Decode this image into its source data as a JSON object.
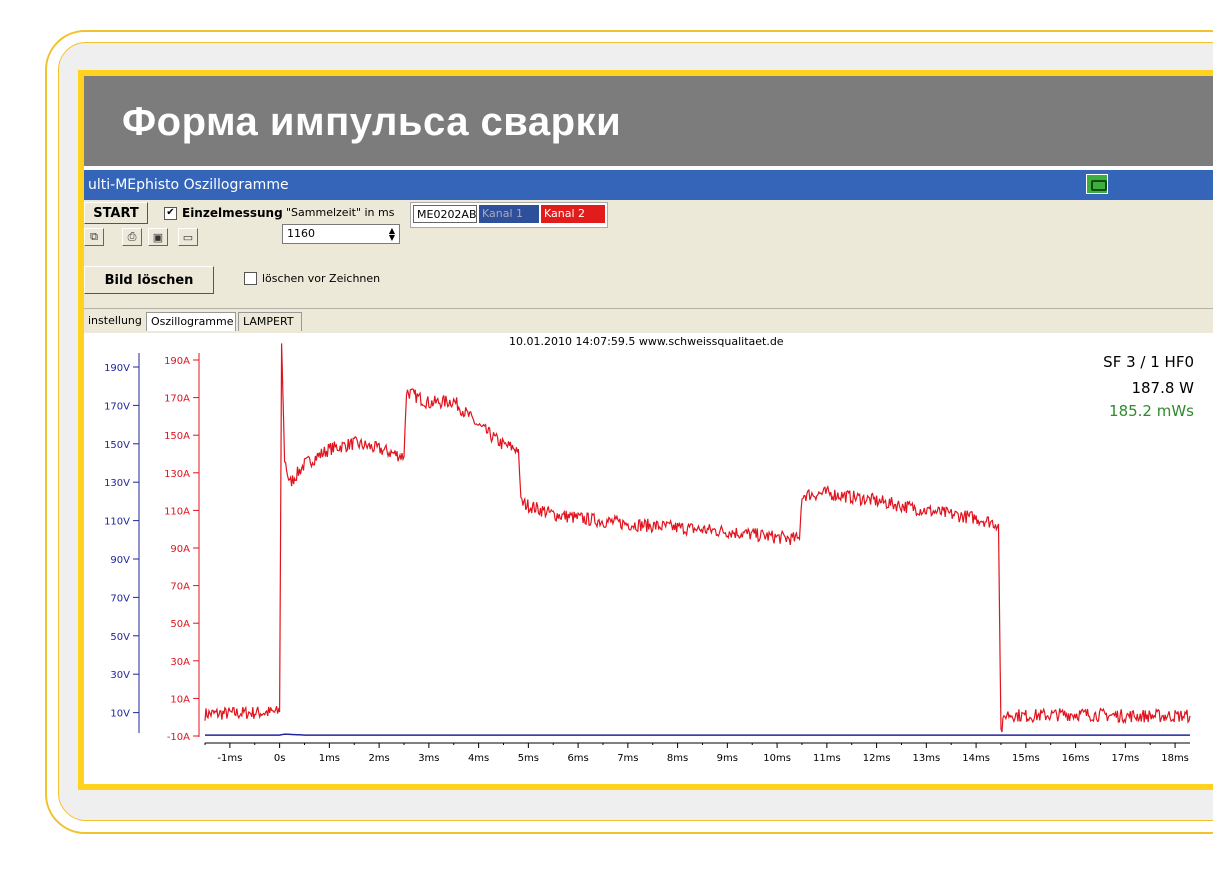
{
  "slide": {
    "title": "Форма импульса сварки"
  },
  "window": {
    "title": "ulti-MEphisto Oszillogramme"
  },
  "toolbar": {
    "start_label": "START",
    "einzelmessung_label": "Einzelmessung",
    "einzelmessung_checked": true,
    "sammelzeit_label": "\"Sammelzeit\" in ms",
    "sammelzeit_value": "1160",
    "bild_loeschen_label": "Bild löschen",
    "loeschen_vor_label": "löschen vor Zeichnen",
    "loeschen_vor_checked": false,
    "device_id": "ME0202AB",
    "channel1_label": "Kanal 1",
    "channel2_label": "Kanal 2",
    "icons": [
      "copy-icon",
      "print-icon",
      "save-icon",
      "open-folder-icon"
    ]
  },
  "tabs": [
    {
      "label": "instellung",
      "active": false
    },
    {
      "label": "Oszillogramme",
      "active": true
    },
    {
      "label": "LAMPERT",
      "active": false
    }
  ],
  "readout": {
    "timestamp": "10.01.2010  14:07:59.5 www.schweissqualitaet.de",
    "program": "SF 3 / 1 HF0",
    "power": "187.8 W",
    "energy": "185.2 mWs"
  },
  "colors": {
    "current": "#e0141e",
    "voltage": "#22269a",
    "energy_text": "#2e8b2e",
    "titlebar": "#3465b8",
    "frame": "#ffd21f"
  },
  "chart_data": {
    "type": "line",
    "x_unit": "ms",
    "x_ticks": [
      "-1ms",
      "0s",
      "1ms",
      "2ms",
      "3ms",
      "4ms",
      "5ms",
      "6ms",
      "7ms",
      "8ms",
      "9ms",
      "10ms",
      "11ms",
      "12ms",
      "13ms",
      "14ms",
      "15ms",
      "16ms",
      "17ms",
      "18ms"
    ],
    "xlim": [
      -1.5,
      18.3
    ],
    "left_axis_ticks": [
      "190V",
      "170V",
      "150V",
      "130V",
      "110V",
      "90V",
      "70V",
      "50V",
      "30V",
      "10V"
    ],
    "right_axis_ticks": [
      "190A",
      "170A",
      "150A",
      "130A",
      "110A",
      "90A",
      "70A",
      "50A",
      "30A",
      "10A",
      "-10A"
    ],
    "ylim_current": [
      -10,
      190
    ],
    "series": [
      {
        "name": "Kanal 2",
        "points": [
          [
            -1.5,
            2
          ],
          [
            0,
            3
          ],
          [
            0.04,
            195
          ],
          [
            0.1,
            135
          ],
          [
            0.2,
            122
          ],
          [
            0.5,
            132
          ],
          [
            1,
            140
          ],
          [
            1.5,
            143
          ],
          [
            2,
            140
          ],
          [
            2.5,
            136
          ],
          [
            2.55,
            170
          ],
          [
            3,
            164
          ],
          [
            3.5,
            165
          ],
          [
            4,
            152
          ],
          [
            4.5,
            142
          ],
          [
            4.8,
            140
          ],
          [
            4.85,
            112
          ],
          [
            5.5,
            106
          ],
          [
            6,
            104
          ],
          [
            7,
            101
          ],
          [
            8,
            99
          ],
          [
            9,
            97
          ],
          [
            10,
            94
          ],
          [
            10.45,
            93
          ],
          [
            10.5,
            116
          ],
          [
            11,
            117
          ],
          [
            12,
            113
          ],
          [
            13,
            108
          ],
          [
            13.5,
            106
          ],
          [
            14,
            104
          ],
          [
            14.45,
            101
          ],
          [
            14.5,
            -7
          ],
          [
            14.6,
            2
          ],
          [
            15,
            1
          ],
          [
            16,
            2
          ],
          [
            17,
            1
          ],
          [
            18.3,
            1
          ]
        ]
      },
      {
        "name": "Kanal 1",
        "points": [
          [
            -1.5,
            -9
          ],
          [
            0,
            -9
          ],
          [
            0.1,
            -8.5
          ],
          [
            0.5,
            -9
          ],
          [
            18.3,
            -9
          ]
        ]
      }
    ]
  }
}
